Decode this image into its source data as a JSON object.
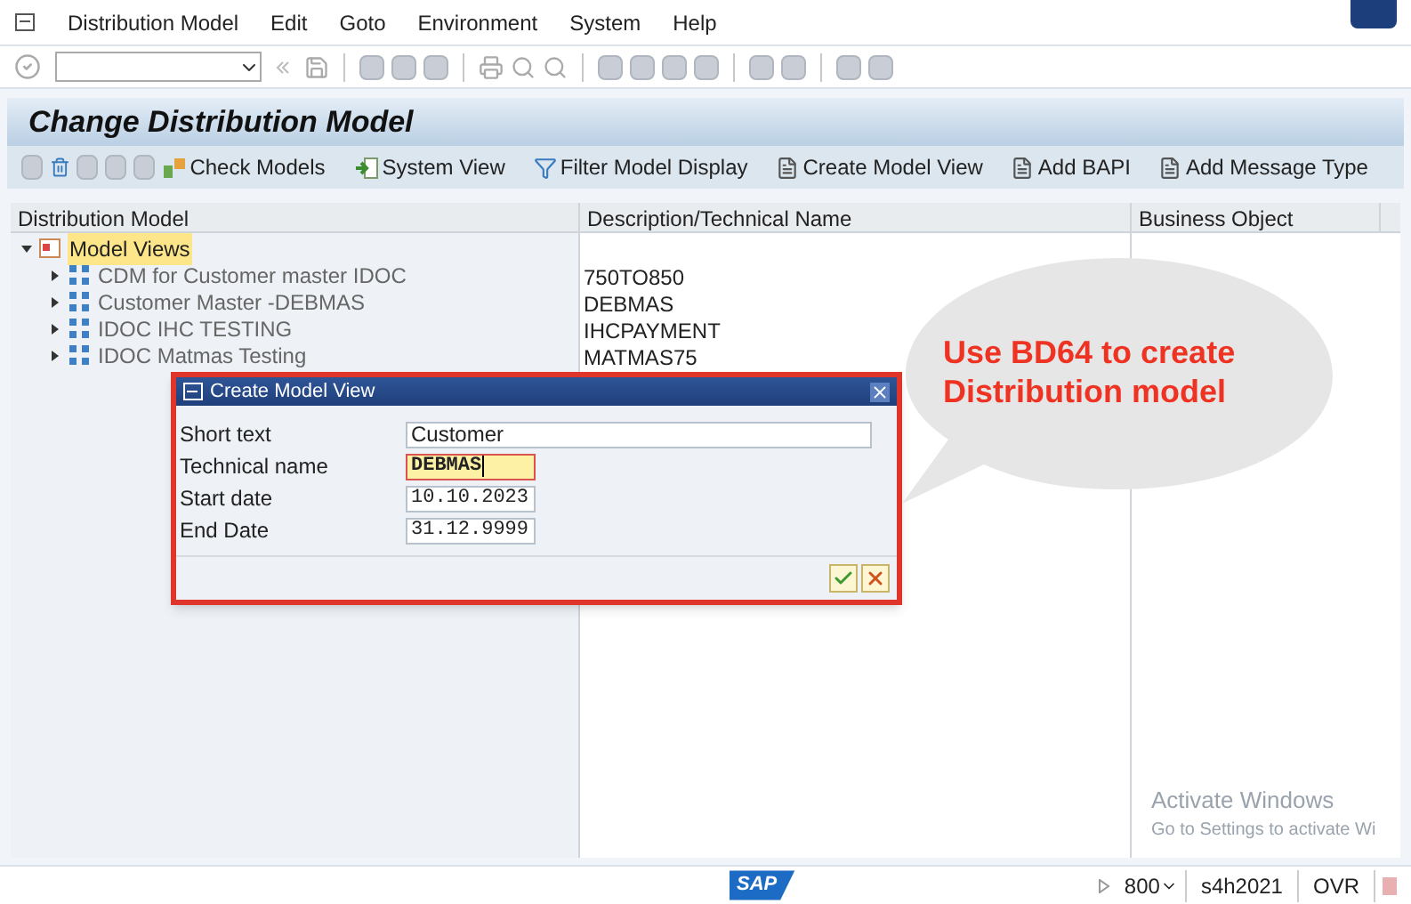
{
  "menu_bar": {
    "items": [
      "Distribution Model",
      "Edit",
      "Goto",
      "Environment",
      "System",
      "Help"
    ]
  },
  "title": "Change Distribution Model",
  "app_toolbar": {
    "buttons": [
      {
        "label": "Check Models",
        "kind": "check"
      },
      {
        "label": "System View",
        "kind": "system"
      },
      {
        "label": "Filter Model Display",
        "kind": "filter"
      },
      {
        "label": "Create Model View",
        "kind": "doc"
      },
      {
        "label": "Add BAPI",
        "kind": "doc"
      },
      {
        "label": "Add Message Type",
        "kind": "doc"
      }
    ]
  },
  "table": {
    "columns": [
      "Distribution Model",
      "Description/Technical Name",
      "Business Object"
    ],
    "tree": [
      {
        "name": "Model Views",
        "selected": true,
        "expanded": true,
        "children": [
          {
            "name": "CDM for Customer master IDOC",
            "technical_name": "750TO850",
            "expanded": false
          },
          {
            "name": "Customer Master -DEBMAS",
            "technical_name": "DEBMAS",
            "expanded": false
          },
          {
            "name": "IDOC IHC TESTING",
            "technical_name": "IHCPAYMENT",
            "expanded": false
          },
          {
            "name": "IDOC Matmas Testing",
            "technical_name": "MATMAS75",
            "expanded": false
          }
        ]
      }
    ]
  },
  "dialog": {
    "title": "Create Model View",
    "fields": [
      {
        "label": "Short text",
        "value": "Customer",
        "focused": false,
        "kind": "text"
      },
      {
        "label": "Technical name",
        "value": "DEBMAS",
        "focused": true,
        "kind": "code"
      },
      {
        "label": "Start date",
        "value": "10.10.2023",
        "focused": false,
        "kind": "code"
      },
      {
        "label": "End Date",
        "value": "31.12.9999",
        "focused": false,
        "kind": "code"
      }
    ]
  },
  "callout": {
    "text": "Use BD64 to create Distribution model"
  },
  "activation_notice": {
    "title": "Activate Windows",
    "text": "Go to Settings to activate Wi"
  },
  "status_bar": {
    "logo": "SAP",
    "client": "800",
    "system": "s4h2021",
    "mode": "OVR"
  }
}
